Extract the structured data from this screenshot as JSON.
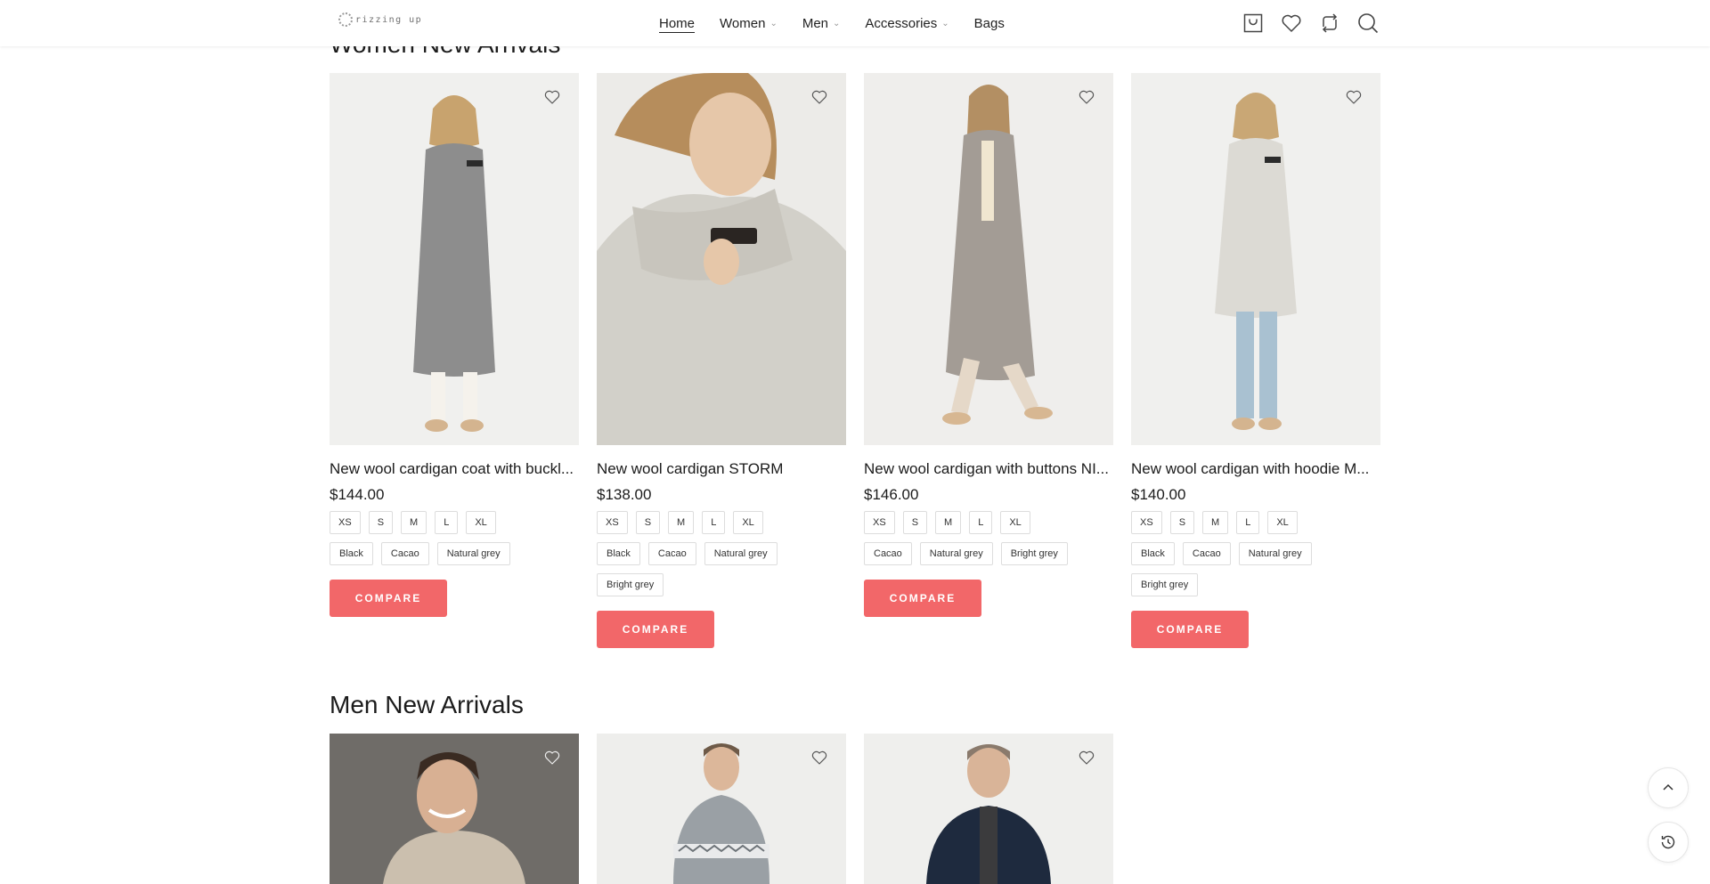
{
  "header": {
    "logo_text": "rizzing up",
    "nav": [
      {
        "label": "Home",
        "active": true,
        "dropdown": false
      },
      {
        "label": "Women",
        "dropdown": true
      },
      {
        "label": "Men",
        "dropdown": true
      },
      {
        "label": "Accessories",
        "dropdown": true
      },
      {
        "label": "Bags",
        "dropdown": false
      }
    ],
    "icons": [
      "cart-icon",
      "heart-icon",
      "compare-icon",
      "search-icon"
    ]
  },
  "women": {
    "title": "Women New Arrivals",
    "products": [
      {
        "name": "New wool cardigan coat with buckle",
        "display_name": "New wool cardigan coat with buckl...",
        "price": "$144.00",
        "sizes": [
          "XS",
          "S",
          "M",
          "L",
          "XL"
        ],
        "colors": [
          "Black",
          "Cacao",
          "Natural grey"
        ],
        "button": "COMPARE"
      },
      {
        "name": "New wool cardigan STORM",
        "display_name": "New wool cardigan STORM",
        "price": "$138.00",
        "sizes": [
          "XS",
          "S",
          "M",
          "L",
          "XL"
        ],
        "colors": [
          "Black",
          "Cacao",
          "Natural grey",
          "Bright grey"
        ],
        "button": "COMPARE"
      },
      {
        "name": "New wool cardigan with buttons NI",
        "display_name": "New wool cardigan with buttons NI...",
        "price": "$146.00",
        "sizes": [
          "XS",
          "S",
          "M",
          "L",
          "XL"
        ],
        "colors": [
          "Cacao",
          "Natural grey",
          "Bright grey"
        ],
        "button": "COMPARE"
      },
      {
        "name": "New wool cardigan with hoodie M",
        "display_name": "New wool cardigan with hoodie M...",
        "price": "$140.00",
        "sizes": [
          "XS",
          "S",
          "M",
          "L",
          "XL"
        ],
        "colors": [
          "Black",
          "Cacao",
          "Natural grey",
          "Bright grey"
        ],
        "button": "COMPARE"
      }
    ]
  },
  "men": {
    "title": "Men New Arrivals",
    "products_visible": 3
  },
  "floating": {
    "scroll_top_icon": "chevron-up-icon",
    "history_icon": "history-icon"
  },
  "colors": {
    "accent": "#f26769",
    "text": "#1b1b1b",
    "border": "#dddddd"
  }
}
